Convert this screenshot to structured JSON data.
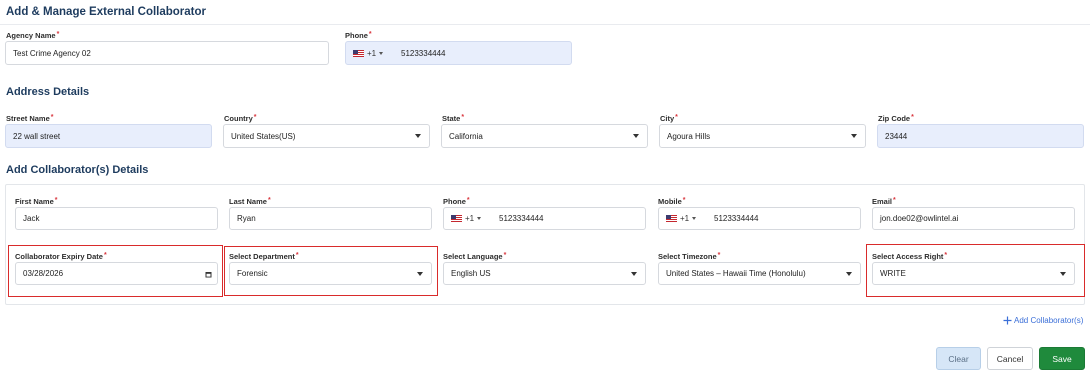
{
  "page": {
    "title": "Add & Manage External Collaborator"
  },
  "agency": {
    "name_label": "Agency Name",
    "name_value": "Test Crime Agency 02",
    "phone_label": "Phone",
    "phone_code": "+1",
    "phone_value": "5123334444"
  },
  "address": {
    "section_title": "Address Details",
    "street_label": "Street Name",
    "street_value": "22 wall street",
    "country_label": "Country",
    "country_value": "United States(US)",
    "state_label": "State",
    "state_value": "California",
    "city_label": "City",
    "city_value": "Agoura Hills",
    "zip_label": "Zip Code",
    "zip_value": "23444"
  },
  "collaborator": {
    "section_title": "Add Collaborator(s) Details",
    "first_name_label": "First Name",
    "first_name_value": "Jack",
    "last_name_label": "Last Name",
    "last_name_value": "Ryan",
    "phone_label": "Phone",
    "phone_code": "+1",
    "phone_value": "5123334444",
    "mobile_label": "Mobile",
    "mobile_code": "+1",
    "mobile_value": "5123334444",
    "email_label": "Email",
    "email_value": "jon.doe02@owlintel.ai",
    "expiry_label": "Collaborator Expiry Date",
    "expiry_value": "03/28/2026",
    "department_label": "Select Department",
    "department_value": "Forensic",
    "language_label": "Select Language",
    "language_value": "English US",
    "timezone_label": "Select Timezone",
    "timezone_value": "United States – Hawaii Time (Honolulu)",
    "access_label": "Select Access Right",
    "access_value": "WRITE"
  },
  "actions": {
    "add_collaborator": "Add Collaborator(s)",
    "clear": "Clear",
    "cancel": "Cancel",
    "save": "Save"
  },
  "colors": {
    "accent_green": "#1f8a3c",
    "highlight_red": "#d92b2b",
    "field_blue": "#e8eefc",
    "link_blue": "#3b6fd8"
  },
  "icons": [
    "us-flag-icon",
    "calendar-icon",
    "plus-icon",
    "chevron-down-icon"
  ]
}
